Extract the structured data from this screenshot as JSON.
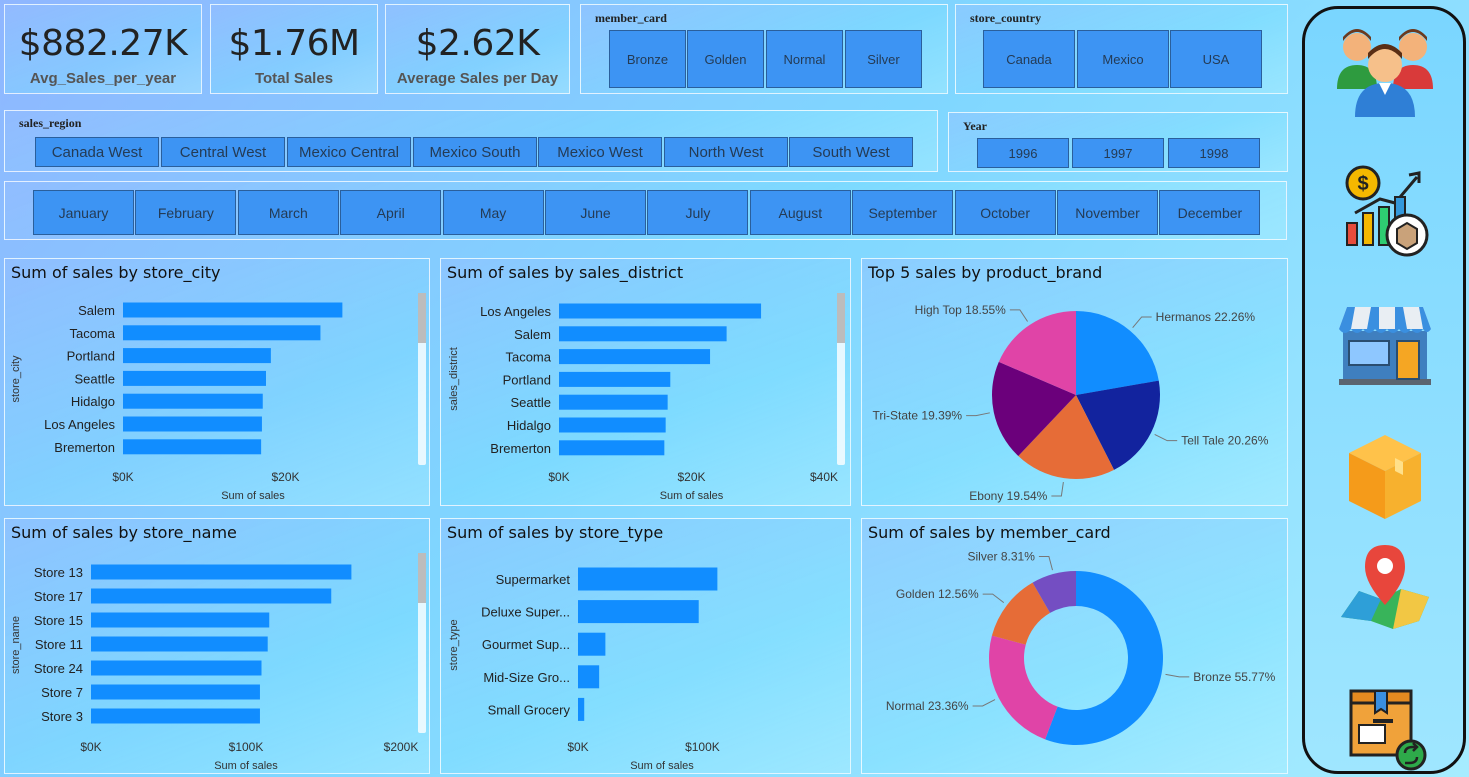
{
  "kpis": [
    {
      "value": "$882.27K",
      "label": "Avg_Sales_per_year"
    },
    {
      "value": "$1.76M",
      "label": "Total Sales"
    },
    {
      "value": "$2.62K",
      "label": "Average Sales per Day"
    }
  ],
  "slicers": {
    "member_card": {
      "title": "member_card",
      "items": [
        "Bronze",
        "Golden",
        "Normal",
        "Silver"
      ]
    },
    "store_country": {
      "title": "store_country",
      "items": [
        "Canada",
        "Mexico",
        "USA"
      ]
    },
    "sales_region": {
      "title": "sales_region",
      "items": [
        "Canada West",
        "Central West",
        "Mexico Central",
        "Mexico South",
        "Mexico West",
        "North West",
        "South West"
      ]
    },
    "year": {
      "title": "Year",
      "items": [
        "1996",
        "1997",
        "1998"
      ]
    },
    "months": [
      "January",
      "February",
      "March",
      "April",
      "May",
      "June",
      "July",
      "August",
      "September",
      "October",
      "November",
      "December"
    ]
  },
  "sidebar": {
    "icons": [
      "customers-icon",
      "sales-growth-icon",
      "store-icon",
      "product-box-icon",
      "map-location-icon",
      "returns-box-icon"
    ]
  },
  "colors": {
    "bar": "#118dff",
    "button": "#3d94f3"
  },
  "chart_data": [
    {
      "id": "store_city",
      "type": "bar",
      "title": "Sum of sales by store_city",
      "ylabel": "store_city",
      "xlabel": "Sum of sales",
      "categories": [
        "Salem",
        "Tacoma",
        "Portland",
        "Seattle",
        "Hidalgo",
        "Los Angeles",
        "Bremerton"
      ],
      "values": [
        27000,
        24300,
        18200,
        17600,
        17200,
        17100,
        17000
      ],
      "xticks": [
        "$0K",
        "$20K"
      ],
      "xtick_values": [
        0,
        20000
      ],
      "xlim": [
        0,
        32000
      ]
    },
    {
      "id": "sales_district",
      "type": "bar",
      "title": "Sum of sales by sales_district",
      "ylabel": "sales_district",
      "xlabel": "Sum of sales",
      "categories": [
        "Los Angeles",
        "Salem",
        "Tacoma",
        "Portland",
        "Seattle",
        "Hidalgo",
        "Bremerton"
      ],
      "values": [
        30500,
        25300,
        22800,
        16800,
        16400,
        16100,
        15900
      ],
      "xticks": [
        "$0K",
        "$20K",
        "$40K"
      ],
      "xtick_values": [
        0,
        20000,
        40000
      ],
      "xlim": [
        0,
        40000
      ]
    },
    {
      "id": "product_brand",
      "type": "pie",
      "title": "Top 5 sales by product_brand",
      "labels": [
        "Hermanos",
        "Tell Tale",
        "Ebony",
        "Tri-State",
        "High Top"
      ],
      "values": [
        22.26,
        20.26,
        19.54,
        19.39,
        18.55
      ],
      "display": [
        "Hermanos 22.26%",
        "Tell Tale 20.26%",
        "Ebony 19.54%",
        "Tri-State 19.39%",
        "High Top 18.55%"
      ],
      "colors": [
        "#118dff",
        "#12239e",
        "#e66c37",
        "#6b007b",
        "#e044a7"
      ]
    },
    {
      "id": "store_name",
      "type": "bar",
      "title": "Sum of sales by store_name",
      "ylabel": "store_name",
      "xlabel": "Sum of sales",
      "categories": [
        "Store 13",
        "Store 17",
        "Store 15",
        "Store 11",
        "Store 24",
        "Store 7",
        "Store 3"
      ],
      "values": [
        168000,
        155000,
        115000,
        114000,
        110000,
        109000,
        109000
      ],
      "xticks": [
        "$0K",
        "$100K",
        "$200K"
      ],
      "xtick_values": [
        0,
        100000,
        200000
      ],
      "xlim": [
        0,
        200000
      ]
    },
    {
      "id": "store_type",
      "type": "bar",
      "title": "Sum of sales by store_type",
      "ylabel": "store_type",
      "xlabel": "Sum of sales",
      "categories": [
        "Supermarket",
        "Deluxe Super...",
        "Gourmet Sup...",
        "Mid-Size Gro...",
        "Small Grocery"
      ],
      "values": [
        112000,
        97000,
        22000,
        17000,
        5000
      ],
      "xticks": [
        "$0K",
        "$100K"
      ],
      "xtick_values": [
        0,
        100000
      ],
      "xlim": [
        0,
        135000
      ]
    },
    {
      "id": "member_card",
      "type": "pie",
      "donut": true,
      "title": "Sum of sales by member_card",
      "labels": [
        "Bronze",
        "Normal",
        "Golden",
        "Silver"
      ],
      "values": [
        55.77,
        23.36,
        12.56,
        8.31
      ],
      "display": [
        "Bronze 55.77%",
        "Normal 23.36%",
        "Golden 12.56%",
        "Silver 8.31%"
      ],
      "colors": [
        "#118dff",
        "#e044a7",
        "#e66c37",
        "#744ec2"
      ]
    }
  ]
}
